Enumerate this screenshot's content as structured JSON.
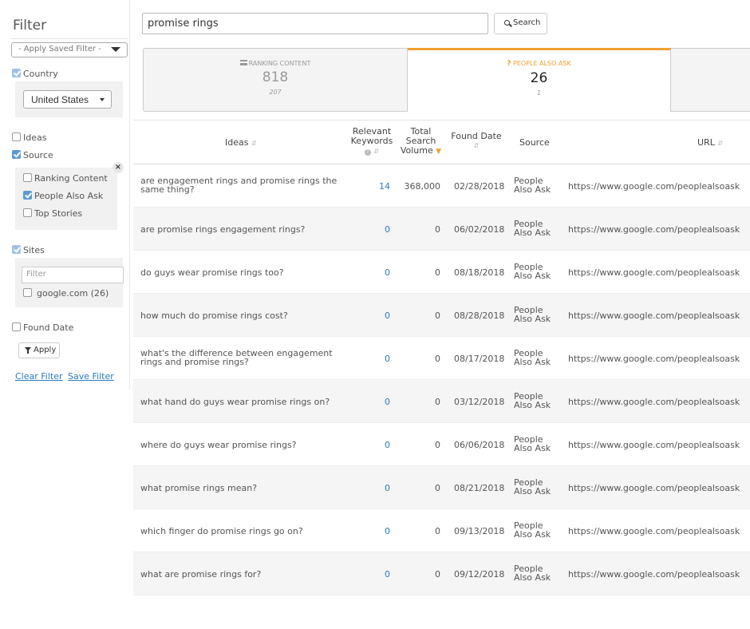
{
  "sidebar": {
    "title": "Filter",
    "saved_filter": "- Apply Saved Filter -",
    "country_label": "Country",
    "country_value": "United States",
    "ideas_label": "Ideas",
    "source_label": "Source",
    "source_close": "×",
    "source_options": [
      {
        "label": "Ranking Content",
        "checked": false
      },
      {
        "label": "People Also Ask",
        "checked": true
      },
      {
        "label": "Top Stories",
        "checked": false
      }
    ],
    "sites_label": "Sites",
    "sites_filter_placeholder": "Filter",
    "site_option": "google.com (26)",
    "found_date_label": "Found Date",
    "apply_label": "Apply",
    "clear_filter": "Clear Filter",
    "save_filter": "Save Filter"
  },
  "search": {
    "query": "promise rings",
    "button_label": "Search"
  },
  "tabs": [
    {
      "label": "Ranking Content",
      "value": "818",
      "sub": "207"
    },
    {
      "label": "People Also Ask",
      "value": "26",
      "sub": "1",
      "icon": "?"
    }
  ],
  "table": {
    "headers": {
      "ideas": "Ideas",
      "keywords_1": "Relevant",
      "keywords_2": "Keywords",
      "volume_1": "Total",
      "volume_2": "Search",
      "volume_3": "Volume",
      "date": "Found Date",
      "source": "Source",
      "url": "URL"
    },
    "rows": [
      {
        "idea": "are engagement rings and promise rings the same thing?",
        "keywords": "14",
        "volume": "368,000",
        "date": "02/28/2018",
        "source_1": "People",
        "source_2": "Also Ask",
        "url": "https://www.google.com/peoplealsoask"
      },
      {
        "idea": "are promise rings engagement rings?",
        "keywords": "0",
        "volume": "0",
        "date": "06/02/2018",
        "source_1": "People",
        "source_2": "Also Ask",
        "url": "https://www.google.com/peoplealsoask"
      },
      {
        "idea": "do guys wear promise rings too?",
        "keywords": "0",
        "volume": "0",
        "date": "08/18/2018",
        "source_1": "People",
        "source_2": "Also Ask",
        "url": "https://www.google.com/peoplealsoask"
      },
      {
        "idea": "how much do promise rings cost?",
        "keywords": "0",
        "volume": "0",
        "date": "08/28/2018",
        "source_1": "People",
        "source_2": "Also Ask",
        "url": "https://www.google.com/peoplealsoask"
      },
      {
        "idea": "what's the difference between engagement rings and promise rings?",
        "keywords": "0",
        "volume": "0",
        "date": "08/17/2018",
        "source_1": "People",
        "source_2": "Also Ask",
        "url": "https://www.google.com/peoplealsoask"
      },
      {
        "idea": "what hand do guys wear promise rings on?",
        "keywords": "0",
        "volume": "0",
        "date": "03/12/2018",
        "source_1": "People",
        "source_2": "Also Ask",
        "url": "https://www.google.com/peoplealsoask"
      },
      {
        "idea": "where do guys wear promise rings?",
        "keywords": "0",
        "volume": "0",
        "date": "06/06/2018",
        "source_1": "People",
        "source_2": "Also Ask",
        "url": "https://www.google.com/peoplealsoask"
      },
      {
        "idea": "what promise rings mean?",
        "keywords": "0",
        "volume": "0",
        "date": "08/21/2018",
        "source_1": "People",
        "source_2": "Also Ask",
        "url": "https://www.google.com/peoplealsoask"
      },
      {
        "idea": "which finger do promise rings go on?",
        "keywords": "0",
        "volume": "0",
        "date": "09/13/2018",
        "source_1": "People",
        "source_2": "Also Ask",
        "url": "https://www.google.com/peoplealsoask"
      },
      {
        "idea": "what are promise rings for?",
        "keywords": "0",
        "volume": "0",
        "date": "09/12/2018",
        "source_1": "People",
        "source_2": "Also Ask",
        "url": "https://www.google.com/peoplealsoask"
      }
    ]
  },
  "colors": {
    "accent": "#f0a030",
    "link": "#2a7ac0",
    "checkbox": "#5b9bd5"
  }
}
